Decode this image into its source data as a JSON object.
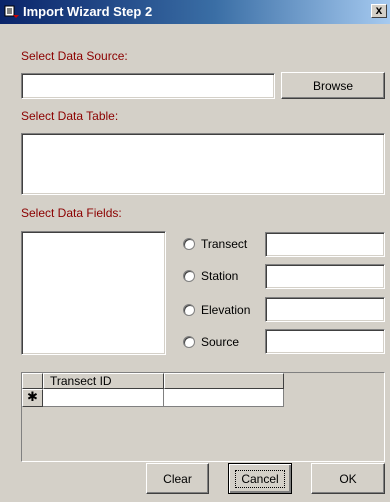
{
  "window": {
    "title": "Import Wizard Step 2",
    "close_glyph": "x"
  },
  "source": {
    "label": "Select Data Source:",
    "value": "",
    "browse_label": "Browse"
  },
  "table": {
    "label": "Select Data Table:",
    "items": []
  },
  "fields": {
    "label": "Select Data Fields:",
    "items": [],
    "options": [
      {
        "label": "Transect",
        "value": ""
      },
      {
        "label": "Station",
        "value": ""
      },
      {
        "label": "Elevation",
        "value": ""
      },
      {
        "label": "Source",
        "value": ""
      }
    ]
  },
  "grid": {
    "columns": [
      "Transect ID",
      ""
    ],
    "new_row_marker": "✱"
  },
  "buttons": {
    "clear": "Clear",
    "cancel": "Cancel",
    "ok": "OK"
  }
}
